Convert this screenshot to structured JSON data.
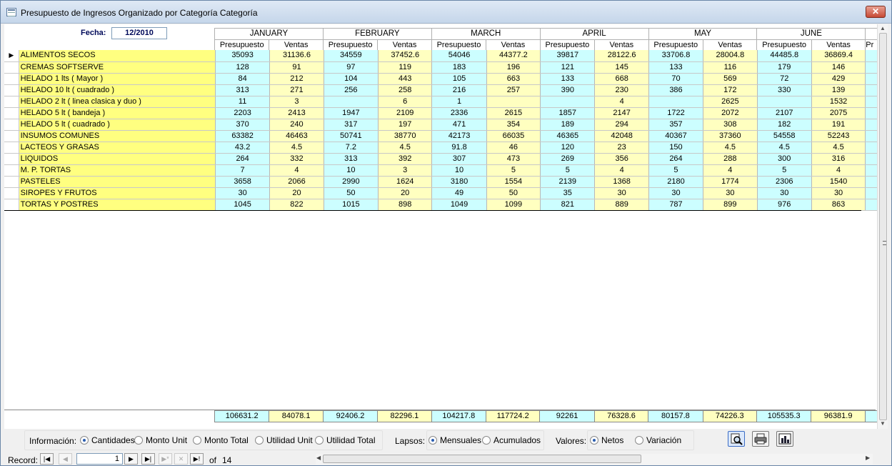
{
  "window": {
    "title": "Presupuesto de Ingresos Organizado por Categoría Categoría",
    "close_glyph": "✕"
  },
  "fecha": {
    "label": "Fecha:",
    "value": "12/2010"
  },
  "months": [
    "JANUARY",
    "FEBRUARY",
    "MARCH",
    "APRIL",
    "MAY",
    "JUNE"
  ],
  "sub_headers": {
    "presupuesto": "Presupuesto",
    "ventas": "Ventas",
    "cut": "Pr"
  },
  "rows": [
    {
      "cat": "ALIMENTOS SECOS",
      "v": [
        "35093",
        "31136.6",
        "34559",
        "37452.6",
        "54046",
        "44377.2",
        "39817",
        "28122.6",
        "33706.8",
        "28004.8",
        "44485.8",
        "36869.4"
      ]
    },
    {
      "cat": "CREMAS SOFTSERVE",
      "v": [
        "128",
        "91",
        "97",
        "119",
        "183",
        "196",
        "121",
        "145",
        "133",
        "116",
        "179",
        "146"
      ]
    },
    {
      "cat": "HELADO 1 lts ( Mayor )",
      "v": [
        "84",
        "212",
        "104",
        "443",
        "105",
        "663",
        "133",
        "668",
        "70",
        "569",
        "72",
        "429"
      ]
    },
    {
      "cat": "HELADO 10 lt ( cuadrado )",
      "v": [
        "313",
        "271",
        "256",
        "258",
        "216",
        "257",
        "390",
        "230",
        "386",
        "172",
        "330",
        "139"
      ]
    },
    {
      "cat": "HELADO 2 lt ( linea clasica y duo )",
      "v": [
        "11",
        "3",
        "",
        "6",
        "1",
        "",
        "",
        "4",
        "",
        "2625",
        "",
        "1532"
      ]
    },
    {
      "cat": "HELADO 5 lt ( bandeja )",
      "v": [
        "2203",
        "2413",
        "1947",
        "2109",
        "2336",
        "2615",
        "1857",
        "2147",
        "1722",
        "2072",
        "2107",
        "2075"
      ]
    },
    {
      "cat": "HELADO 5 lt ( cuadrado )",
      "v": [
        "370",
        "240",
        "317",
        "197",
        "471",
        "354",
        "189",
        "294",
        "357",
        "308",
        "182",
        "191"
      ]
    },
    {
      "cat": "INSUMOS COMUNES",
      "v": [
        "63382",
        "46463",
        "50741",
        "38770",
        "42173",
        "66035",
        "46365",
        "42048",
        "40367",
        "37360",
        "54558",
        "52243"
      ]
    },
    {
      "cat": "LACTEOS Y GRASAS",
      "v": [
        "43.2",
        "4.5",
        "7.2",
        "4.5",
        "91.8",
        "46",
        "120",
        "23",
        "150",
        "4.5",
        "4.5",
        "4.5"
      ]
    },
    {
      "cat": "LIQUIDOS",
      "v": [
        "264",
        "332",
        "313",
        "392",
        "307",
        "473",
        "269",
        "356",
        "264",
        "288",
        "300",
        "316"
      ]
    },
    {
      "cat": "M. P. TORTAS",
      "v": [
        "7",
        "4",
        "10",
        "3",
        "10",
        "5",
        "5",
        "4",
        "5",
        "4",
        "5",
        "4"
      ]
    },
    {
      "cat": "PASTELES",
      "v": [
        "3658",
        "2066",
        "2990",
        "1624",
        "3180",
        "1554",
        "2139",
        "1368",
        "2180",
        "1774",
        "2306",
        "1540"
      ]
    },
    {
      "cat": "SIROPES Y FRUTOS",
      "v": [
        "30",
        "20",
        "50",
        "20",
        "49",
        "50",
        "35",
        "30",
        "30",
        "30",
        "30",
        "30"
      ]
    },
    {
      "cat": "TORTAS Y POSTRES",
      "v": [
        "1045",
        "822",
        "1015",
        "898",
        "1049",
        "1099",
        "821",
        "889",
        "787",
        "899",
        "976",
        "863"
      ]
    }
  ],
  "totals": [
    "106631.2",
    "84078.1",
    "92406.2",
    "82296.1",
    "104217.8",
    "117724.2",
    "92261",
    "76328.6",
    "80157.8",
    "74226.3",
    "105535.3",
    "96381.9"
  ],
  "informacion": {
    "label": "Información:",
    "options": [
      "Cantidades",
      "Monto Unit",
      "Monto Total",
      "Utilidad Unit",
      "Utilidad Total"
    ],
    "selected": "Cantidades"
  },
  "lapsos": {
    "label": "Lapsos:",
    "options": [
      "Mensuales",
      "Acumulados"
    ],
    "selected": "Mensuales"
  },
  "valores": {
    "label": "Valores:",
    "options": [
      "Netos",
      "Variación"
    ],
    "selected": "Netos"
  },
  "record_nav": {
    "label": "Record:",
    "current": "1",
    "of_label": "of",
    "total": "14"
  },
  "icons": [
    "preview-icon",
    "print-icon",
    "chart-icon"
  ]
}
